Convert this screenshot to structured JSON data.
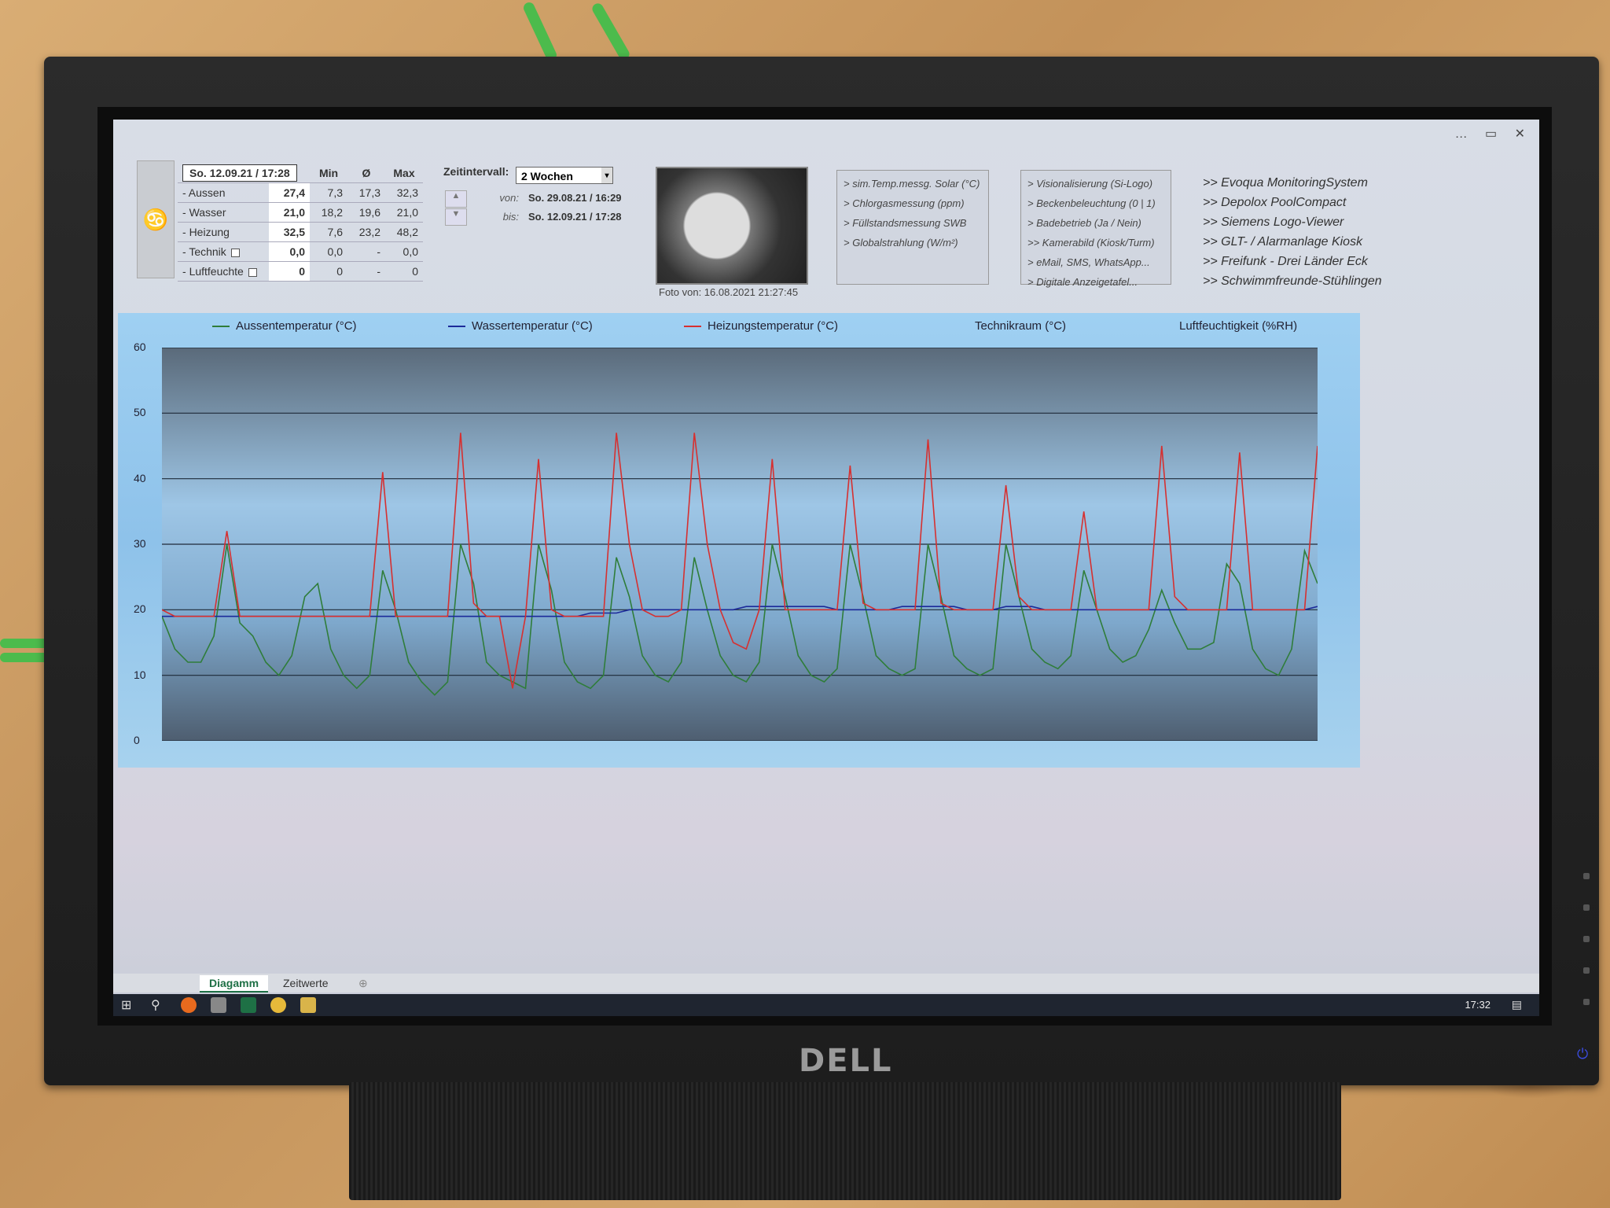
{
  "window": {
    "controls": [
      "…",
      "▭",
      "✕"
    ]
  },
  "status_table": {
    "datetime": "So. 12.09.21 / 17:28",
    "headers": [
      "Min",
      "Ø",
      "Max"
    ],
    "rows": [
      {
        "label": "Aussen",
        "current": "27,4",
        "min": "7,3",
        "avg": "17,3",
        "max": "32,3",
        "checkbox": false
      },
      {
        "label": "Wasser",
        "current": "21,0",
        "min": "18,2",
        "avg": "19,6",
        "max": "21,0",
        "checkbox": false
      },
      {
        "label": "Heizung",
        "current": "32,5",
        "min": "7,6",
        "avg": "23,2",
        "max": "48,2",
        "checkbox": false
      },
      {
        "label": "Technik",
        "current": "0,0",
        "min": "0,0",
        "avg": "-",
        "max": "0,0",
        "checkbox": true
      },
      {
        "label": "Luftfeuchte",
        "current": "0",
        "min": "0",
        "avg": "-",
        "max": "0",
        "checkbox": true
      }
    ],
    "icon": "sensor-symbol-icon"
  },
  "interval": {
    "label": "Zeitintervall:",
    "selected": "2 Wochen",
    "from_label": "von:",
    "from_value": "So. 29.08.21 / 16:29",
    "to_label": "bis:",
    "to_value": "So. 12.09.21 / 17:28"
  },
  "photo": {
    "caption": "Foto von: 16.08.2021 21:27:45"
  },
  "links_box_1": [
    "> sim.Temp.messg. Solar (°C)",
    "> Chlorgasmessung (ppm)",
    "> Füllstandsmessung SWB",
    "> Globalstrahlung (W/m²)"
  ],
  "links_box_2": [
    "> Visionalisierung (Si-Logo)",
    "> Beckenbeleuchtung (0 | 1)",
    "> Badebetrieb (Ja / Nein)",
    ">> Kamerabild (Kiosk/Turm)",
    "> eMail, SMS, WhatsApp...",
    "> Digitale Anzeigetafel..."
  ],
  "external_links": [
    ">> Evoqua MonitoringSystem",
    ">> Depolox PoolCompact",
    ">> Siemens Logo-Viewer",
    ">> GLT- / Alarmanlage Kiosk",
    ">> Freifunk - Drei Länder Eck",
    ">> Schwimmfreunde-Stühlingen"
  ],
  "chart_data": {
    "type": "line",
    "ylim": [
      0,
      60
    ],
    "yticks": [
      0,
      10,
      20,
      30,
      40,
      50,
      60
    ],
    "grid": true,
    "legend_position": "top",
    "series": [
      {
        "name": "Aussentemperatur (°C)",
        "color": "#2f7d3a",
        "values": [
          19,
          14,
          12,
          12,
          16,
          30,
          18,
          16,
          12,
          10,
          13,
          22,
          24,
          14,
          10,
          8,
          10,
          26,
          20,
          12,
          9,
          7,
          9,
          30,
          24,
          12,
          10,
          9,
          8,
          30,
          23,
          12,
          9,
          8,
          10,
          28,
          22,
          13,
          10,
          9,
          12,
          28,
          20,
          13,
          10,
          9,
          12,
          30,
          22,
          13,
          10,
          9,
          11,
          30,
          22,
          13,
          11,
          10,
          11,
          30,
          22,
          13,
          11,
          10,
          11,
          30,
          22,
          14,
          12,
          11,
          13,
          26,
          20,
          14,
          12,
          13,
          17,
          23,
          18,
          14,
          14,
          15,
          27,
          24,
          14,
          11,
          10,
          14,
          29,
          24
        ]
      },
      {
        "name": "Wassertemperatur (°C)",
        "color": "#1c2a9a",
        "values": [
          19,
          19,
          19,
          19,
          19,
          19,
          19,
          19,
          19,
          19,
          19,
          19,
          19,
          19,
          19,
          19,
          19,
          19,
          19,
          19,
          19,
          19,
          19,
          19,
          19,
          19,
          19,
          19,
          19,
          19,
          19,
          19,
          19,
          19.5,
          19.5,
          19.5,
          20,
          20,
          20,
          20,
          20,
          20,
          20,
          20,
          20,
          20.5,
          20.5,
          20.5,
          20.5,
          20.5,
          20.5,
          20.5,
          20,
          20,
          20,
          20,
          20,
          20.5,
          20.5,
          20.5,
          20.5,
          20.5,
          20,
          20,
          20,
          20.5,
          20.5,
          20.5,
          20,
          20,
          20,
          20,
          20,
          20,
          20,
          20,
          20,
          20,
          20,
          20,
          20,
          20,
          20,
          20,
          20,
          20,
          20,
          20,
          20,
          20.5
        ]
      },
      {
        "name": "Heizungstemperatur (°C)",
        "color": "#d63030",
        "values": [
          20,
          19,
          19,
          19,
          19,
          32,
          19,
          19,
          19,
          19,
          19,
          19,
          19,
          19,
          19,
          19,
          19,
          41,
          19,
          19,
          19,
          19,
          19,
          47,
          21,
          19,
          19,
          8,
          19,
          43,
          20,
          19,
          19,
          19,
          19,
          47,
          30,
          20,
          19,
          19,
          20,
          47,
          30,
          20,
          15,
          14,
          20,
          43,
          20,
          20,
          20,
          20,
          20,
          42,
          21,
          20,
          20,
          20,
          20,
          46,
          21,
          20,
          20,
          20,
          20,
          39,
          22,
          20,
          20,
          20,
          20,
          35,
          20,
          20,
          20,
          20,
          20,
          45,
          22,
          20,
          20,
          20,
          20,
          44,
          20,
          20,
          20,
          20,
          20,
          45
        ]
      },
      {
        "name": "Technikraum (°C)",
        "color": "#333333",
        "values": []
      },
      {
        "name": "Luftfeuchtigkeit (%RH)",
        "color": "#333333",
        "values": []
      }
    ]
  },
  "sheet_tabs": [
    "Diagamm",
    "Zeitwerte"
  ],
  "taskbar": {
    "time": "17:32"
  },
  "monitor": {
    "brand": "DELL"
  }
}
